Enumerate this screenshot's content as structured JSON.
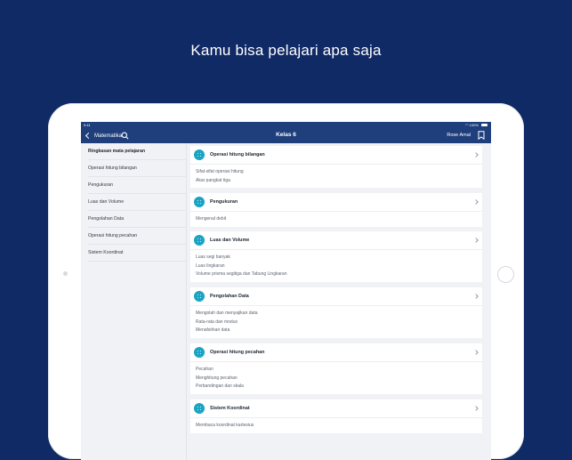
{
  "hero": {
    "title": "Kamu bisa pelajari apa saja"
  },
  "status_bar": {
    "time": "9:41",
    "battery": "100%"
  },
  "nav": {
    "back_label": "Matematika",
    "title": "Kelas 6",
    "user_name": "Rose Amal"
  },
  "sidebar": {
    "items": [
      {
        "label": "Ringkasan mata pelajaran",
        "active": true
      },
      {
        "label": "Operasi hitung bilangan"
      },
      {
        "label": "Pengukuran"
      },
      {
        "label": "Luas dan Volume"
      },
      {
        "label": "Pengolahan Data"
      },
      {
        "label": "Operasi hitung pecahan"
      },
      {
        "label": "Sistem Koordinat"
      }
    ]
  },
  "cards": [
    {
      "title": "Operasi hitung bilangan",
      "items": [
        "Sifat-sifat operasi hitung",
        "Akar pangkat tiga"
      ]
    },
    {
      "title": "Pengukuran",
      "items": [
        "Mengenal debit"
      ]
    },
    {
      "title": "Luas dan Volume",
      "items": [
        "Luas segi banyak",
        "Luas lingkaran",
        "Volume prisma segitiga dan Tabung Lingkaran"
      ]
    },
    {
      "title": "Pengolahan Data",
      "items": [
        "Mengolah dan menyajikan data",
        "Rata-rata dan modus",
        "Menafsirkan data"
      ]
    },
    {
      "title": "Operasi hitung pecahan",
      "items": [
        "Pecahan",
        "Menghitung pecahan",
        "Perbandingan dan skala"
      ]
    },
    {
      "title": "Sistem Koordinat",
      "items": [
        "Membaca koordinat kartesius"
      ]
    }
  ],
  "colors": {
    "background": "#102a66",
    "nav_bar": "#1f3f7c",
    "topic_icon": "#1aa3c2"
  }
}
